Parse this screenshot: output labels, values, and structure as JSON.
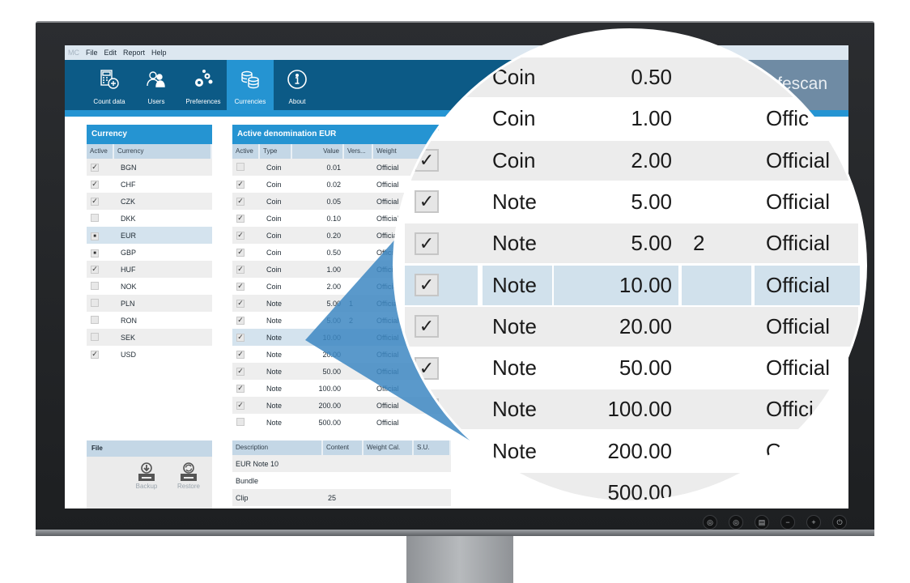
{
  "menu": {
    "app_label": "MC",
    "items": [
      "File",
      "Edit",
      "Report",
      "Help"
    ]
  },
  "toolbar": {
    "items": [
      {
        "label": "Count data",
        "icon": "calculator-add-icon",
        "active": false
      },
      {
        "label": "Users",
        "icon": "users-icon",
        "active": false
      },
      {
        "label": "Preferences",
        "icon": "gears-icon",
        "active": false
      },
      {
        "label": "Currencies",
        "icon": "coins-stack-icon",
        "active": true
      },
      {
        "label": "About",
        "icon": "info-icon",
        "active": false
      }
    ],
    "brand": "fescan"
  },
  "currency_panel": {
    "title": "Currency",
    "columns": [
      "Active",
      "Currency"
    ],
    "rows": [
      {
        "active": "check",
        "code": "BGN"
      },
      {
        "active": "check",
        "code": "CHF"
      },
      {
        "active": "check",
        "code": "CZK"
      },
      {
        "active": "empty",
        "code": "DKK"
      },
      {
        "active": "partial",
        "code": "EUR",
        "selected": true
      },
      {
        "active": "partial",
        "code": "GBP"
      },
      {
        "active": "check",
        "code": "HUF"
      },
      {
        "active": "empty",
        "code": "NOK"
      },
      {
        "active": "empty",
        "code": "PLN"
      },
      {
        "active": "empty",
        "code": "RON"
      },
      {
        "active": "empty",
        "code": "SEK"
      },
      {
        "active": "check",
        "code": "USD"
      }
    ]
  },
  "denomination_panel": {
    "title": "Active denomination EUR",
    "columns": [
      "Active",
      "Type",
      "Value",
      "Vers...",
      "Weight"
    ],
    "rows": [
      {
        "active": false,
        "type": "Coin",
        "value": "0.01",
        "version": "",
        "weight": "Official"
      },
      {
        "active": true,
        "type": "Coin",
        "value": "0.02",
        "version": "",
        "weight": "Official"
      },
      {
        "active": true,
        "type": "Coin",
        "value": "0.05",
        "version": "",
        "weight": "Official"
      },
      {
        "active": true,
        "type": "Coin",
        "value": "0.10",
        "version": "",
        "weight": "Official"
      },
      {
        "active": true,
        "type": "Coin",
        "value": "0.20",
        "version": "",
        "weight": "Official"
      },
      {
        "active": true,
        "type": "Coin",
        "value": "0.50",
        "version": "",
        "weight": "Official"
      },
      {
        "active": true,
        "type": "Coin",
        "value": "1.00",
        "version": "",
        "weight": "Official"
      },
      {
        "active": true,
        "type": "Coin",
        "value": "2.00",
        "version": "",
        "weight": "Official"
      },
      {
        "active": true,
        "type": "Note",
        "value": "5.00",
        "version": "1",
        "weight": "Official"
      },
      {
        "active": true,
        "type": "Note",
        "value": "5.00",
        "version": "2",
        "weight": "Official"
      },
      {
        "active": true,
        "type": "Note",
        "value": "10.00",
        "version": "",
        "weight": "Official",
        "selected": true
      },
      {
        "active": true,
        "type": "Note",
        "value": "20.00",
        "version": "",
        "weight": "Official"
      },
      {
        "active": true,
        "type": "Note",
        "value": "50.00",
        "version": "",
        "weight": "Official"
      },
      {
        "active": true,
        "type": "Note",
        "value": "100.00",
        "version": "",
        "weight": "Official"
      },
      {
        "active": true,
        "type": "Note",
        "value": "200.00",
        "version": "",
        "weight": "Official"
      },
      {
        "active": false,
        "type": "Note",
        "value": "500.00",
        "version": "",
        "weight": "Official"
      }
    ]
  },
  "file_panel": {
    "title": "File",
    "actions": [
      {
        "label": "Backup",
        "icon": "backup-icon"
      },
      {
        "label": "Restore",
        "icon": "restore-icon"
      }
    ]
  },
  "description_panel": {
    "columns": [
      "Description",
      "Content",
      "Weight Cal.",
      "S.U."
    ],
    "rows": [
      {
        "description": "EUR Note 10",
        "content": ""
      },
      {
        "description": "Bundle",
        "content": ""
      },
      {
        "description": "Clip",
        "content": "25"
      }
    ]
  },
  "magnifier": {
    "rows": [
      {
        "active": true,
        "type": "Coin",
        "value": "0.50",
        "version": "",
        "weight": ""
      },
      {
        "active": true,
        "type": "Coin",
        "value": "1.00",
        "version": "",
        "weight": "Offic"
      },
      {
        "active": true,
        "type": "Coin",
        "value": "2.00",
        "version": "",
        "weight": "Official"
      },
      {
        "active": true,
        "type": "Note",
        "value": "5.00",
        "version": "",
        "weight": "Official"
      },
      {
        "active": true,
        "type": "Note",
        "value": "5.00",
        "version": "2",
        "weight": "Official"
      },
      {
        "active": true,
        "type": "Note",
        "value": "10.00",
        "version": "",
        "weight": "Official",
        "selected": true
      },
      {
        "active": true,
        "type": "Note",
        "value": "20.00",
        "version": "",
        "weight": "Official"
      },
      {
        "active": true,
        "type": "Note",
        "value": "50.00",
        "version": "",
        "weight": "Official"
      },
      {
        "active": true,
        "type": "Note",
        "value": "100.00",
        "version": "",
        "weight": "Offici"
      },
      {
        "active": true,
        "type": "Note",
        "value": "200.00",
        "version": "",
        "weight": "O"
      },
      {
        "active": false,
        "type": "Note",
        "value": "500.00",
        "version": "",
        "weight": ""
      }
    ]
  },
  "monitor_buttons": [
    "input-1-icon",
    "input-2-icon",
    "menu-icon",
    "minus-icon",
    "plus-icon",
    "power-icon"
  ],
  "colors": {
    "toolbar_bg": "#0c5a86",
    "accent": "#2594d2",
    "header_row": "#c4d7e6",
    "selection": "#d4e3ee",
    "pointer": "#3d87c2"
  }
}
